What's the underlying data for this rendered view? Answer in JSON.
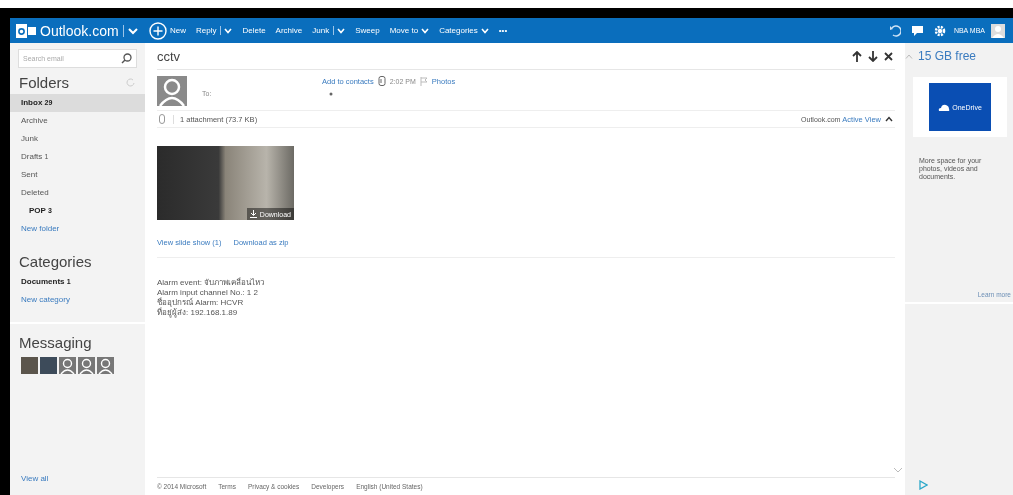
{
  "header": {
    "logo": "Outlook.com",
    "toolbar": [
      {
        "label": "New",
        "kind": "new"
      },
      {
        "label": "Reply",
        "kind": "split"
      },
      {
        "label": "Delete",
        "kind": "plain"
      },
      {
        "label": "Archive",
        "kind": "plain"
      },
      {
        "label": "Junk",
        "kind": "split"
      },
      {
        "label": "Sweep",
        "kind": "plain"
      },
      {
        "label": "Move to",
        "kind": "menu"
      },
      {
        "label": "Categories",
        "kind": "menu"
      },
      {
        "label": "•••",
        "kind": "plain"
      }
    ],
    "user": "NBA MBA"
  },
  "sidebar": {
    "search": {
      "placeholder": "Search email"
    },
    "folders_heading": "Folders",
    "folders": [
      {
        "name": "Inbox",
        "count": "29",
        "selected": true,
        "unread": true
      },
      {
        "name": "Archive",
        "selected": false,
        "unread": false
      },
      {
        "name": "Junk",
        "selected": false,
        "unread": false
      },
      {
        "name": "Drafts",
        "count": "1",
        "selected": false,
        "unread": false
      },
      {
        "name": "Sent",
        "selected": false,
        "unread": false
      },
      {
        "name": "Deleted",
        "selected": false,
        "unread": false,
        "children": [
          {
            "name": "POP",
            "count": "3",
            "selected": false,
            "unread": true
          }
        ]
      }
    ],
    "new_folder": "New folder",
    "categories_heading": "Categories",
    "categories": [
      {
        "name": "Documents",
        "count": "1",
        "selected": false,
        "unread": true
      }
    ],
    "new_category": "New category",
    "messaging_heading": "Messaging",
    "contacts": [
      {
        "kind": "photo"
      },
      {
        "kind": "photo"
      },
      {
        "kind": "silhouette"
      },
      {
        "kind": "silhouette"
      },
      {
        "kind": "silhouette"
      }
    ],
    "view_all": "View all"
  },
  "message": {
    "subject": "cctv",
    "add_to_contacts": "Add to contacts",
    "time": "2:02 PM",
    "flag": "Photos",
    "to_label": "To:",
    "attachment_summary": "1 attachment (73.7 KB)",
    "active_view_brand": "Outlook.com",
    "active_view_link": "Active View",
    "thumbnail_download": "Download",
    "slide_show": "View slide show (1)",
    "download_zip": "Download as zip",
    "body": [
      "Alarm event: จับภาพเคลื่อนไหว",
      "Alarm input channel No.: 1 2",
      "ชื่ออุปกรณ์ Alarm: HCVR",
      "ที่อยู่ผู้ส่ง: 192.168.1.89"
    ]
  },
  "footer": [
    "© 2014 Microsoft",
    "Terms",
    "Privacy & cookies",
    "Developers",
    "English (United States)"
  ],
  "right_pane": {
    "storage": "15 GB free",
    "tile_label": "OneDrive",
    "promo": "More space for your photos, videos and documents.",
    "learn_more": "Learn more"
  }
}
